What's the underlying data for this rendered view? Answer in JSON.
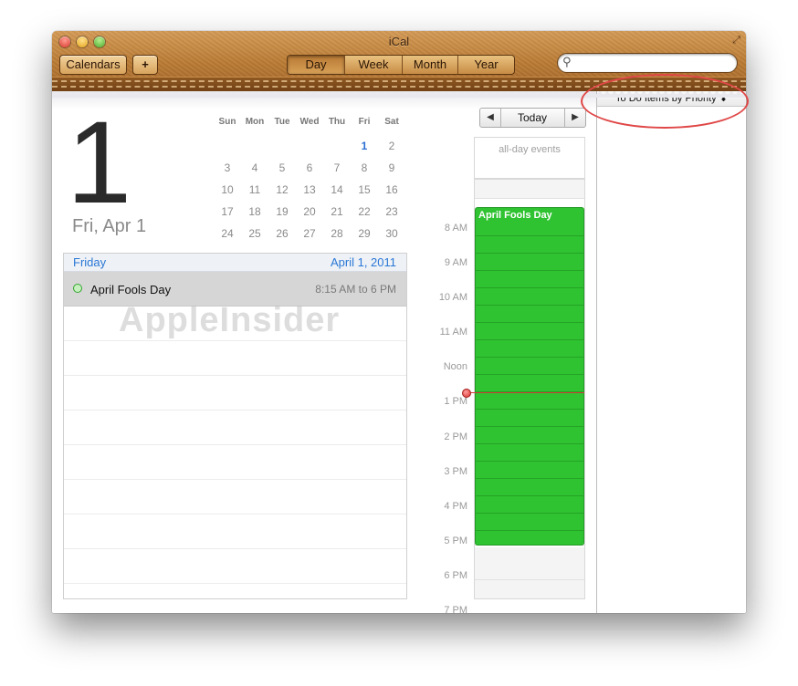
{
  "window": {
    "title": "iCal"
  },
  "toolbar": {
    "calendars_label": "Calendars",
    "add_label": "+",
    "views": [
      "Day",
      "Week",
      "Month",
      "Year"
    ],
    "active_view": "Day",
    "search_placeholder": ""
  },
  "day": {
    "big_number": "1",
    "date_label": "Fri, Apr 1"
  },
  "mini_calendar": {
    "weekdays": [
      "Sun",
      "Mon",
      "Tue",
      "Wed",
      "Thu",
      "Fri",
      "Sat"
    ],
    "weeks": [
      [
        "",
        "",
        "",
        "",
        "",
        "1",
        "2"
      ],
      [
        "3",
        "4",
        "5",
        "6",
        "7",
        "8",
        "9"
      ],
      [
        "10",
        "11",
        "12",
        "13",
        "14",
        "15",
        "16"
      ],
      [
        "17",
        "18",
        "19",
        "20",
        "21",
        "22",
        "23"
      ],
      [
        "24",
        "25",
        "26",
        "27",
        "28",
        "29",
        "30"
      ]
    ],
    "today": "1"
  },
  "event_list": {
    "day_name": "Friday",
    "date": "April 1, 2011",
    "events": [
      {
        "title": "April Fools Day",
        "time": "8:15 AM to 6 PM"
      }
    ]
  },
  "watermark": "AppleInsider",
  "timeline": {
    "today_label": "Today",
    "prev_label": "◀",
    "next_label": "▶",
    "allday_label": "all-day events",
    "hours": [
      "8 AM",
      "9 AM",
      "10 AM",
      "11 AM",
      "Noon",
      "1 PM",
      "2 PM",
      "3 PM",
      "4 PM",
      "5 PM",
      "6 PM",
      "7 PM"
    ],
    "event_title": "April Fools Day"
  },
  "todo": {
    "header_label": "To Do Items by Priority ⬍"
  },
  "colors": {
    "event_green": "#2fc231",
    "accent_blue": "#2a78d6",
    "annotation_red": "#e04747"
  }
}
